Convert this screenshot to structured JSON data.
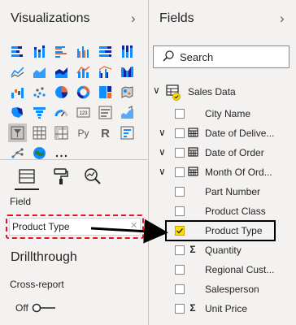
{
  "visualizations": {
    "title": "Visualizations",
    "visual_icons": [
      "stacked-bar-chart",
      "stacked-column-chart",
      "clustered-bar-chart",
      "clustered-column-chart",
      "100-stacked-bar-chart",
      "100-stacked-column-chart",
      "line-chart",
      "area-chart",
      "stacked-area-chart",
      "line-and-column-chart",
      "line-and-clustered-column-chart",
      "ribbon-chart",
      "waterfall-chart",
      "scatter-chart",
      "pie-chart",
      "donut-chart",
      "treemap",
      "map",
      "filled-map",
      "funnel",
      "gauge",
      "card",
      "multi-row-card",
      "kpi",
      "slicer",
      "table",
      "matrix",
      "python-visual",
      "r-script-visual",
      "key-influencers",
      "decomposition-tree",
      "arcgis-map",
      "more"
    ],
    "field_label": "Field",
    "field_well_value": "Product Type",
    "drillthrough_title": "Drillthrough",
    "cross_report_label": "Cross-report",
    "toggle_label": "Off"
  },
  "fields": {
    "title": "Fields",
    "search_placeholder": "Search",
    "table_name": "Sales Data",
    "items": [
      {
        "name": "City Name",
        "expandable": false,
        "type": "none",
        "checked": false
      },
      {
        "name": "Date of Delive...",
        "expandable": true,
        "type": "calendar",
        "checked": false
      },
      {
        "name": "Date of Order",
        "expandable": true,
        "type": "calendar",
        "checked": false
      },
      {
        "name": "Month Of Ord...",
        "expandable": true,
        "type": "calendar",
        "checked": false
      },
      {
        "name": "Part Number",
        "expandable": false,
        "type": "none",
        "checked": false
      },
      {
        "name": "Product Class",
        "expandable": false,
        "type": "none",
        "checked": false
      },
      {
        "name": "Product Type",
        "expandable": false,
        "type": "none",
        "checked": true
      },
      {
        "name": "Quantity",
        "expandable": false,
        "type": "sigma",
        "checked": false
      },
      {
        "name": "Regional Cust...",
        "expandable": false,
        "type": "none",
        "checked": false
      },
      {
        "name": "Salesperson",
        "expandable": false,
        "type": "none",
        "checked": false
      },
      {
        "name": "Unit Price",
        "expandable": false,
        "type": "sigma",
        "checked": false
      }
    ]
  },
  "colors": {
    "pane_background": "#f3f2f1",
    "check_yellow": "#fce100",
    "annotation_red": "#e81123",
    "chart_blue": "#118dff",
    "chart_orange": "#e66c37",
    "chart_navy": "#12239e"
  }
}
